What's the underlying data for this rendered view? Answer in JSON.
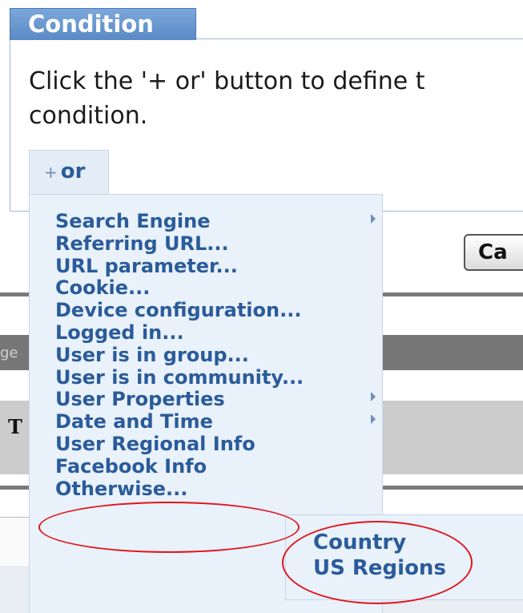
{
  "condition": {
    "title": "Condition",
    "instruction": "Click the '+ or' button to define t\ncondition.",
    "or_button": {
      "plus": "+",
      "label": "or"
    }
  },
  "background": {
    "cancel_label": "Ca",
    "gray_bar_text": "ge",
    "gray_box_text": "T"
  },
  "menu": {
    "items": [
      {
        "label": "Search Engine",
        "has_submenu": true
      },
      {
        "label": "Referring URL...",
        "has_submenu": false
      },
      {
        "label": "URL parameter...",
        "has_submenu": false
      },
      {
        "label": "Cookie...",
        "has_submenu": false
      },
      {
        "label": "Device configuration...",
        "has_submenu": false
      },
      {
        "label": "Logged in...",
        "has_submenu": false
      },
      {
        "label": "User is in group...",
        "has_submenu": false
      },
      {
        "label": "User is in community...",
        "has_submenu": false
      },
      {
        "label": "User Properties",
        "has_submenu": true
      },
      {
        "label": "Date and Time",
        "has_submenu": true
      },
      {
        "label": "User Regional Info",
        "has_submenu": true
      },
      {
        "label": "Facebook Info",
        "has_submenu": false
      },
      {
        "label": "Otherwise...",
        "has_submenu": false
      }
    ],
    "submenu": {
      "items": [
        {
          "label": "Country"
        },
        {
          "label": "US Regions"
        }
      ]
    }
  },
  "colors": {
    "accent": "#2a5b9a",
    "menu_bg": "#e9f1fa",
    "tab_bg": "#5a8ac6",
    "highlight": "#e0151b"
  }
}
